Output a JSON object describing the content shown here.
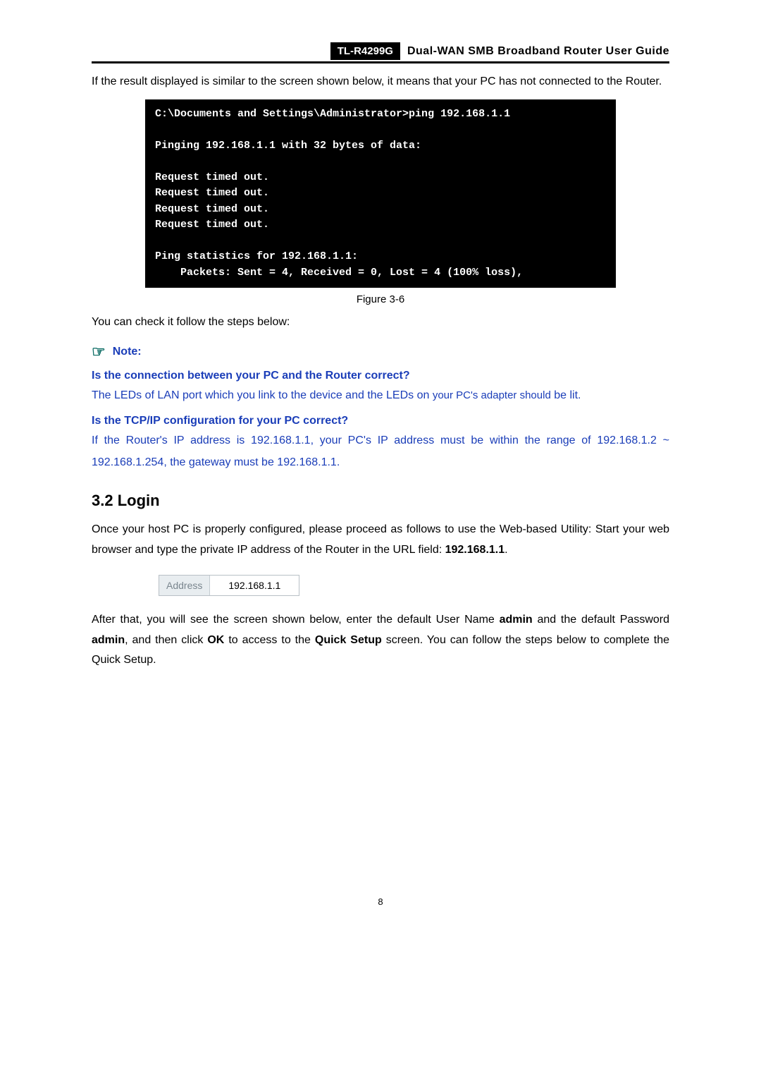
{
  "header": {
    "model": "TL-R4299G",
    "title": "Dual-WAN SMB Broadband Router User Guide"
  },
  "intro_text": "If the result displayed is similar to the screen shown below, it means that your PC has not connected to the Router.",
  "cmd": {
    "line1": "C:\\Documents and Settings\\Administrator>ping 192.168.1.1",
    "line2": "Pinging 192.168.1.1 with 32 bytes of data:",
    "req1": "Request timed out.",
    "req2": "Request timed out.",
    "req3": "Request timed out.",
    "req4": "Request timed out.",
    "stats1": "Ping statistics for 192.168.1.1:",
    "stats2": "    Packets: Sent = 4, Received = 0, Lost = 4 (100% loss),"
  },
  "figure_caption": "Figure 3-6",
  "check_text": "You can check it follow the steps below:",
  "note_label": "Note:",
  "q1": "Is the connection between your PC and the Router correct?",
  "a1_part1": "The LEDs of LAN port which you link to the device and the LEDs on ",
  "a1_part2": "your PC's adapter should",
  "a1_part3": " be lit.",
  "q2": "Is the TCP/IP configuration for your PC correct?",
  "a2": "If the Router's IP address is 192.168.1.1, your PC's IP address must be within the range of 192.168.1.2 ~ 192.168.1.254, the gateway must be 192.168.1.1.",
  "section_heading": "3.2   Login",
  "login_p1_part1": "Once your host PC is properly configured, please proceed as follows to use the Web-based Utility: Start your web browser and type the private IP address of the Router in the URL field: ",
  "login_p1_bold": "192.168.1.1",
  "login_p1_end": ".",
  "address_label": "Address",
  "address_value": "192.168.1.1",
  "login_p2_a": "After that, you will see the screen shown below, enter the default User Name ",
  "login_p2_b": "admin",
  "login_p2_c": " and the default Password ",
  "login_p2_d": "admin",
  "login_p2_e": ", and then click ",
  "login_p2_f": "OK",
  "login_p2_g": " to access to the ",
  "login_p2_h": "Quick Setup",
  "login_p2_i": " screen. You can follow the steps below to complete the Quick Setup.",
  "page_number": "8"
}
